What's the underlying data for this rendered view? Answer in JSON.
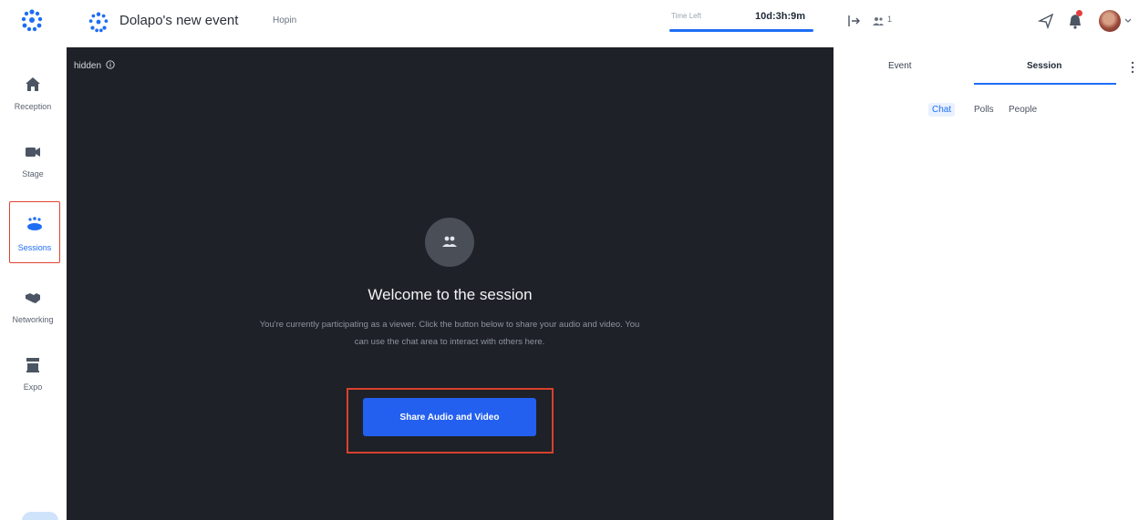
{
  "sidebar": {
    "items": [
      {
        "label": "Reception",
        "icon": "home-icon"
      },
      {
        "label": "Stage",
        "icon": "video-camera-icon"
      },
      {
        "label": "Sessions",
        "icon": "sessions-group-icon",
        "active": true
      },
      {
        "label": "Networking",
        "icon": "handshake-icon"
      },
      {
        "label": "Expo",
        "icon": "booth-icon"
      }
    ]
  },
  "header": {
    "event_title": "Dolapo's new event",
    "organizer": "Hopin",
    "time_left_label": "Time Left",
    "time_left_value": "10d:3h:9m",
    "attendee_count": "1"
  },
  "stage": {
    "visibility_label": "hidden",
    "welcome_title": "Welcome to the session",
    "description": "You're currently participating as a viewer. Click the button below to share your audio and video. You can use the chat area to interact with others here.",
    "share_button_label": "Share Audio and Video"
  },
  "panel": {
    "tabs": [
      {
        "label": "Event"
      },
      {
        "label": "Session",
        "active": true
      }
    ],
    "subtabs": [
      {
        "label": "Chat",
        "active": true
      },
      {
        "label": "Polls"
      },
      {
        "label": "People"
      }
    ]
  },
  "colors": {
    "accent": "#1e6ef5",
    "stage_bg": "#1e2127",
    "button": "#2360f0",
    "highlight_frame": "#d8412d"
  }
}
